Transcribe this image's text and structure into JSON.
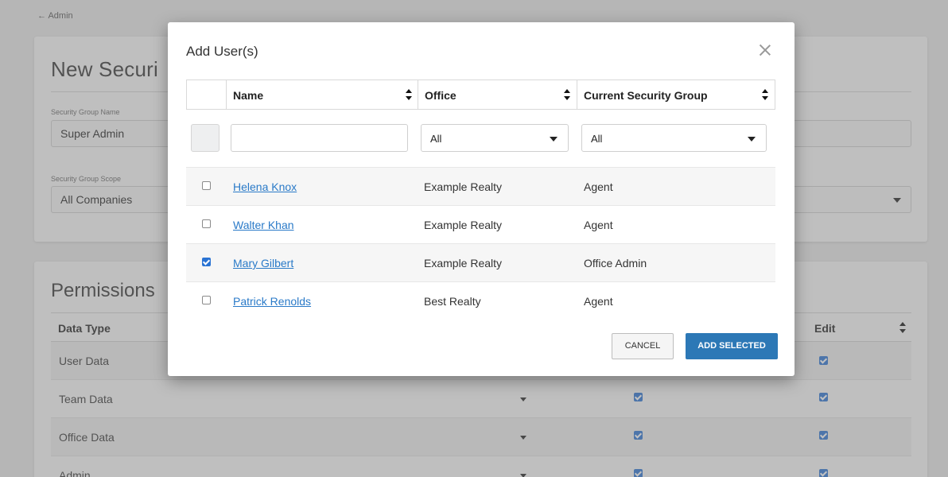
{
  "page": {
    "back_link": "← Admin",
    "title": "New Securi",
    "group_name_label": "Security Group Name",
    "group_name_value": "Super Admin",
    "scope_label": "Security Group Scope",
    "scope_value": "All Companies",
    "permissions_title": "Permissions",
    "perm_headers": {
      "data_type": "Data Type",
      "edit": "Edit"
    },
    "perm_rows": [
      {
        "label": "User Data",
        "edit": true
      },
      {
        "label": "Team Data",
        "view": true,
        "edit": true
      },
      {
        "label": "Office Data",
        "view": true,
        "edit": true
      },
      {
        "label": "Admin",
        "view": true,
        "edit": true
      }
    ]
  },
  "modal": {
    "title": "Add User(s)",
    "headers": {
      "name": "Name",
      "office": "Office",
      "group": "Current Security Group"
    },
    "filters": {
      "name_value": "",
      "office_value": "All",
      "group_value": "All"
    },
    "users": [
      {
        "name": "Helena Knox",
        "office": "Example Realty",
        "group": "Agent",
        "checked": false
      },
      {
        "name": "Walter Khan",
        "office": "Example Realty",
        "group": "Agent",
        "checked": false
      },
      {
        "name": "Mary Gilbert",
        "office": "Example Realty",
        "group": "Office Admin",
        "checked": true
      },
      {
        "name": "Patrick Renolds",
        "office": "Best Realty",
        "group": "Agent",
        "checked": false
      }
    ],
    "cancel_label": "CANCEL",
    "add_label": "ADD SELECTED"
  },
  "colors": {
    "accent": "#2c78b6",
    "link": "#2a7ac8",
    "checkbox": "#2a73d3"
  }
}
